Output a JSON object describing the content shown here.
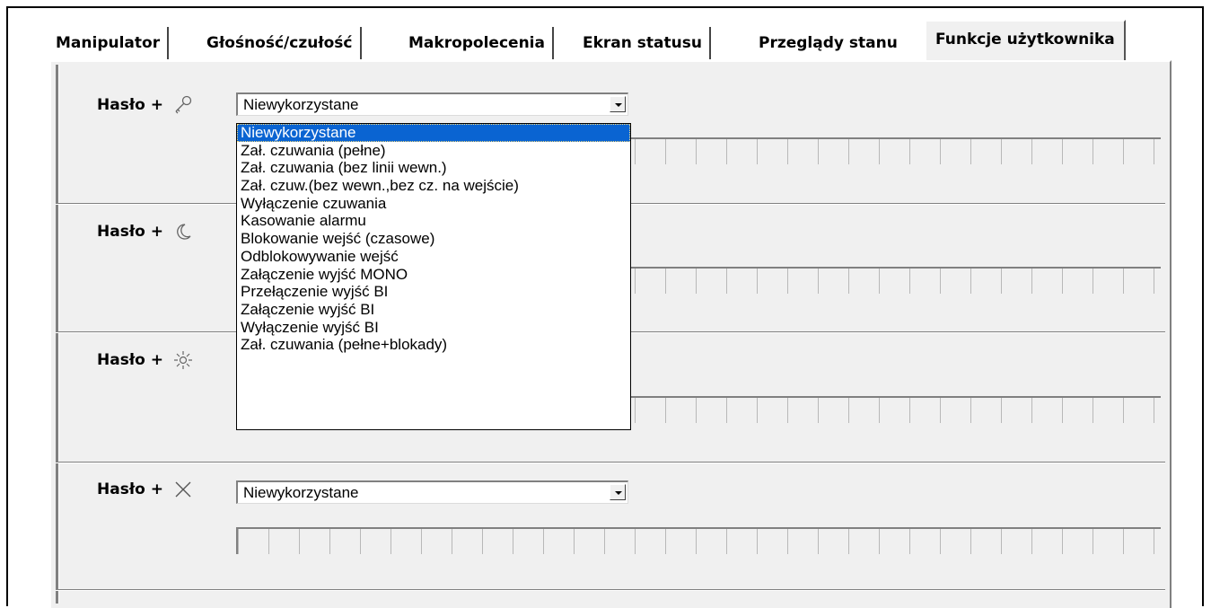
{
  "tabs": [
    {
      "label": "Manipulator"
    },
    {
      "label": "Głośność/czułość"
    },
    {
      "label": "Makropolecenia"
    },
    {
      "label": "Ekran statusu"
    },
    {
      "label": "Przeglądy stanu"
    },
    {
      "label": "Funkcje użytkownika",
      "active": true
    }
  ],
  "rows": [
    {
      "label": "Hasło +",
      "icon": "key-icon",
      "value": "Niewykorzystane"
    },
    {
      "label": "Hasło +",
      "icon": "moon-icon",
      "value": ""
    },
    {
      "label": "Hasło +",
      "icon": "sun-icon",
      "value": ""
    },
    {
      "label": "Hasło +",
      "icon": "x-icon",
      "value": "Niewykorzystane"
    }
  ],
  "dropdown": {
    "selected": "Niewykorzystane",
    "options": [
      "Niewykorzystane",
      "Zał. czuwania (pełne)",
      "Zał. czuwania (bez linii wewn.)",
      "Zał. czuw.(bez wewn.,bez cz. na wejście)",
      "Wyłączenie czuwania",
      "Kasowanie alarmu",
      "Blokowanie wejść (czasowe)",
      "Odblokowywanie wejść",
      "Załączenie wyjść MONO",
      "Przełączenie wyjść BI",
      "Załączenie wyjść BI",
      "Wyłączenie wyjść BI",
      "Zał. czuwania (pełne+blokady)"
    ]
  },
  "colors": {
    "selection": "#0a64d2",
    "panel": "#f0f0f0"
  }
}
